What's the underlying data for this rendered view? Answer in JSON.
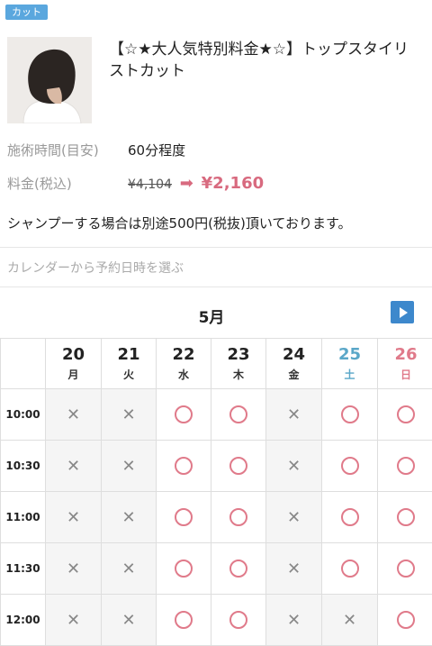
{
  "tag": "カット",
  "menu": {
    "title": "【☆★大人気特別料金★☆】トップスタイリストカット",
    "thumbnail_alt": "hairstyle-photo"
  },
  "details": {
    "time_label": "施術時間(目安)",
    "time_value": "60分程度",
    "price_label": "料金(税込)",
    "old_price": "¥4,104",
    "arrow": "➡",
    "new_price": "¥2,160"
  },
  "note": "シャンプーする場合は別途500円(税抜)頂いております。",
  "calendar": {
    "prompt": "カレンダーから予約日時を選ぶ",
    "month": "5月",
    "next_icon": "play-icon",
    "days": [
      {
        "num": "20",
        "weekday": "月",
        "type": "weekday"
      },
      {
        "num": "21",
        "weekday": "火",
        "type": "weekday"
      },
      {
        "num": "22",
        "weekday": "水",
        "type": "weekday"
      },
      {
        "num": "23",
        "weekday": "木",
        "type": "weekday"
      },
      {
        "num": "24",
        "weekday": "金",
        "type": "weekday"
      },
      {
        "num": "25",
        "weekday": "土",
        "type": "sat"
      },
      {
        "num": "26",
        "weekday": "日",
        "type": "sun"
      }
    ],
    "slots": [
      {
        "time": "10:00",
        "avail": [
          "×",
          "×",
          "○",
          "○",
          "×",
          "○",
          "○"
        ]
      },
      {
        "time": "10:30",
        "avail": [
          "×",
          "×",
          "○",
          "○",
          "×",
          "○",
          "○"
        ]
      },
      {
        "time": "11:00",
        "avail": [
          "×",
          "×",
          "○",
          "○",
          "×",
          "○",
          "○"
        ]
      },
      {
        "time": "11:30",
        "avail": [
          "×",
          "×",
          "○",
          "○",
          "×",
          "○",
          "○"
        ]
      },
      {
        "time": "12:00",
        "avail": [
          "×",
          "×",
          "○",
          "○",
          "×",
          "×",
          "○"
        ]
      }
    ],
    "colors": {
      "available": "#e07a8a",
      "sat": "#5aa7c8",
      "sun": "#e07a8a",
      "next_button": "#3d88cc"
    }
  }
}
